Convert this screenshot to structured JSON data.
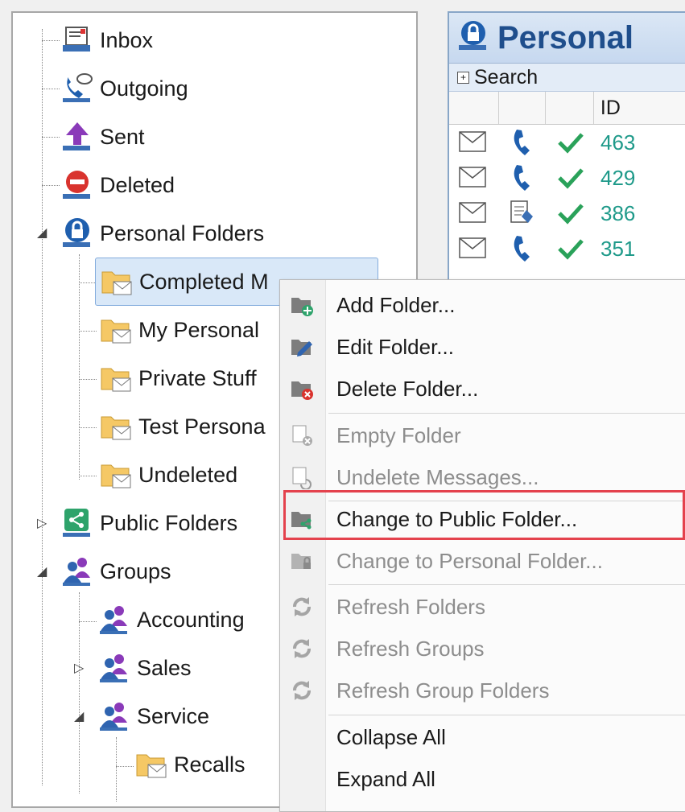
{
  "tree": {
    "items": [
      {
        "label": "Inbox",
        "icon": "inbox-icon"
      },
      {
        "label": "Outgoing",
        "icon": "outgoing-phone-icon"
      },
      {
        "label": "Sent",
        "icon": "sent-arrow-icon"
      },
      {
        "label": "Deleted",
        "icon": "deleted-icon"
      },
      {
        "label": "Personal Folders",
        "icon": "lock-icon"
      },
      {
        "label": "Completed M",
        "icon": "folder-mail-icon"
      },
      {
        "label": "My Personal",
        "icon": "folder-mail-icon"
      },
      {
        "label": "Private Stuff",
        "icon": "folder-mail-icon"
      },
      {
        "label": "Test Persona",
        "icon": "folder-mail-icon"
      },
      {
        "label": "Undeleted",
        "icon": "folder-mail-icon"
      },
      {
        "label": "Public Folders",
        "icon": "share-icon"
      },
      {
        "label": "Groups",
        "icon": "group-icon"
      },
      {
        "label": "Accounting",
        "icon": "group-icon"
      },
      {
        "label": "Sales",
        "icon": "group-icon"
      },
      {
        "label": "Service",
        "icon": "group-icon"
      },
      {
        "label": "Recalls",
        "icon": "folder-mail-icon"
      }
    ]
  },
  "message_panel": {
    "title": "Personal",
    "search_label": "Search",
    "column_id": "ID",
    "rows": [
      {
        "id": "463",
        "type": "phone"
      },
      {
        "id": "429",
        "type": "phone"
      },
      {
        "id": "386",
        "type": "note"
      },
      {
        "id": "351",
        "type": "phone"
      }
    ]
  },
  "context_menu": {
    "items": [
      {
        "label": "Add Folder...",
        "enabled": true,
        "icon": "add-folder-icon"
      },
      {
        "label": "Edit Folder...",
        "enabled": true,
        "icon": "edit-folder-icon"
      },
      {
        "label": "Delete Folder...",
        "enabled": true,
        "icon": "delete-folder-icon"
      },
      {
        "label": "Empty Folder",
        "enabled": false,
        "icon": "empty-folder-icon"
      },
      {
        "label": "Undelete Messages...",
        "enabled": false,
        "icon": "undelete-icon"
      },
      {
        "label": "Change to Public Folder...",
        "enabled": true,
        "icon": "public-folder-icon"
      },
      {
        "label": "Change to Personal Folder...",
        "enabled": false,
        "icon": "personal-folder-icon"
      },
      {
        "label": "Refresh Folders",
        "enabled": false,
        "icon": "refresh-icon"
      },
      {
        "label": "Refresh Groups",
        "enabled": false,
        "icon": "refresh-icon"
      },
      {
        "label": "Refresh Group Folders",
        "enabled": false,
        "icon": "refresh-icon"
      },
      {
        "label": "Collapse All",
        "enabled": true,
        "icon": ""
      },
      {
        "label": "Expand All",
        "enabled": true,
        "icon": ""
      }
    ]
  },
  "colors": {
    "accent": "#1f4e8c",
    "highlight": "#e4424d",
    "id_text": "#1f9a8a",
    "check": "#2aa25a"
  }
}
